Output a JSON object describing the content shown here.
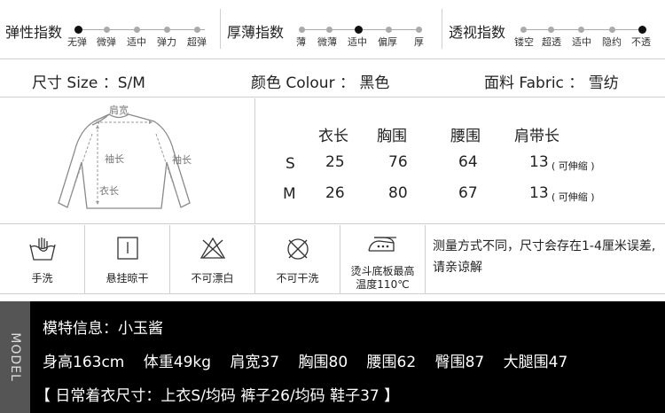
{
  "indices": [
    {
      "title": "弹性指数",
      "levels": [
        "无弹",
        "微弹",
        "适中",
        "弹力",
        "超弹"
      ],
      "selected": 0
    },
    {
      "title": "厚薄指数",
      "levels": [
        "薄",
        "微薄",
        "适中",
        "偏厚",
        "厚"
      ],
      "selected": 2
    },
    {
      "title": "透视指数",
      "levels": [
        "镂空",
        "超透",
        "适中",
        "隐约",
        "不透"
      ],
      "selected": 4
    }
  ],
  "attributes": {
    "size": "尺寸 Size ：S/M",
    "colour": "颜色 Colour ： 黑色",
    "fabric": "面料 Fabric ： 雪纺"
  },
  "diagram": {
    "shoulder": "肩宽",
    "sleeve_left": "袖长",
    "sleeve_right": "袖长",
    "length": "衣长"
  },
  "size_table": {
    "headers": [
      "衣长",
      "胸围",
      "腰围",
      "肩带长"
    ],
    "rows": [
      {
        "size": "S",
        "values": [
          "25",
          "76",
          "64",
          "13"
        ],
        "note": "( 可伸缩 )"
      },
      {
        "size": "M",
        "values": [
          "26",
          "80",
          "67",
          "13"
        ],
        "note": "( 可伸缩 )"
      }
    ]
  },
  "care": [
    {
      "icon": "hand-wash-icon",
      "label": "手洗"
    },
    {
      "icon": "hang-dry-icon",
      "label": "悬挂晾干"
    },
    {
      "icon": "no-bleach-icon",
      "label": "不可漂白"
    },
    {
      "icon": "no-dry-clean-icon",
      "label": "不可干洗"
    },
    {
      "icon": "iron-icon",
      "label": "烫斗底板最高",
      "label2": "温度110℃"
    }
  ],
  "care_note": "测量方式不同，尺寸会存在1-4厘米误差,请亲谅解",
  "model": {
    "tab": "MODEL",
    "info": "模特信息：小玉酱",
    "measurements": [
      "身高163cm",
      "体重49kg",
      "肩宽37",
      "胸围80",
      "腰围62",
      "臀围87",
      "大腿围47"
    ],
    "daily": "【 日常着衣尺寸：上衣S/均码   裤子26/均码   鞋子37 】"
  }
}
